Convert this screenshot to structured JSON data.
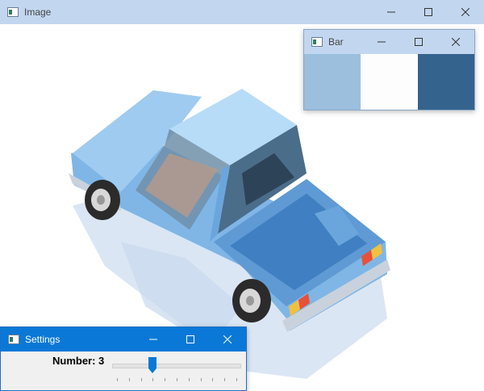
{
  "image_window": {
    "title": "Image",
    "icon": "app-window-icon",
    "controls": [
      "minimize",
      "maximize",
      "close"
    ]
  },
  "bar_window": {
    "title": "Bar",
    "icon": "app-window-icon",
    "controls": [
      "minimize",
      "maximize",
      "close"
    ],
    "swatches": [
      {
        "color": "#9bbfdc"
      },
      {
        "color": "#fdfdfd"
      },
      {
        "color": "#34638e"
      }
    ]
  },
  "settings_window": {
    "title": "Settings",
    "icon": "app-window-icon",
    "controls": [
      "minimize",
      "maximize",
      "close"
    ],
    "number_label": "Number: 3",
    "slider": {
      "value": 3,
      "min": 0,
      "max": 10
    }
  },
  "colors": {
    "active_titlebar": "#0a78d7",
    "inactive_titlebar": "#c2d7ef",
    "truck_body": "#7fb6e6",
    "truck_dark": "#3f7fc2"
  }
}
